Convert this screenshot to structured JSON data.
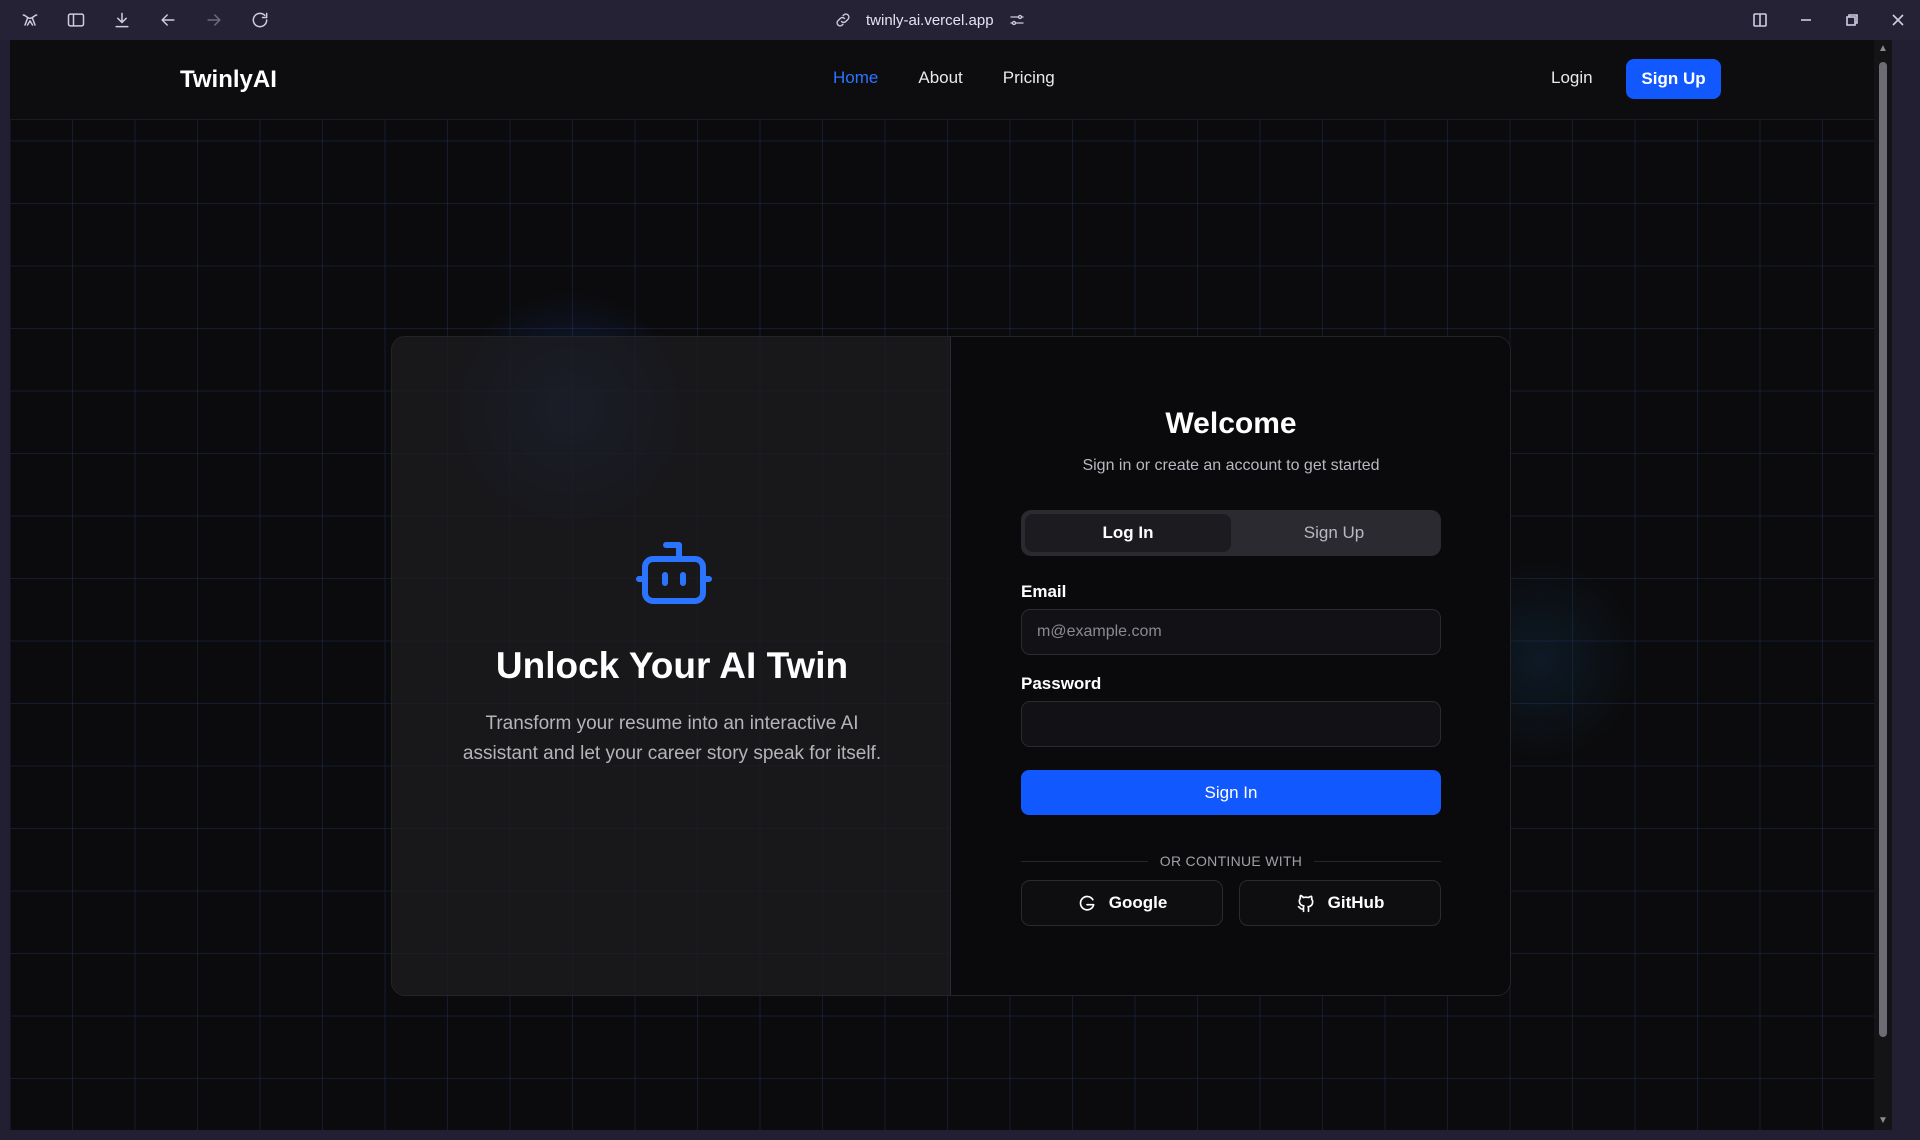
{
  "browser": {
    "url": "twinly-ai.vercel.app"
  },
  "nav": {
    "logo": "TwinlyAI",
    "links": [
      {
        "label": "Home",
        "active": true
      },
      {
        "label": "About",
        "active": false
      },
      {
        "label": "Pricing",
        "active": false
      }
    ],
    "login": "Login",
    "signup": "Sign Up"
  },
  "hero": {
    "icon": "bot-icon",
    "title": "Unlock Your AI Twin",
    "text": "Transform your resume into an interactive AI assistant and let your career story speak for itself."
  },
  "auth": {
    "title": "Welcome",
    "subtitle": "Sign in or create an account to get started",
    "tabs": [
      {
        "label": "Log In",
        "active": true
      },
      {
        "label": "Sign Up",
        "active": false
      }
    ],
    "email_label": "Email",
    "email_placeholder": "m@example.com",
    "email_value": "",
    "password_label": "Password",
    "password_value": "",
    "submit": "Sign In",
    "divider": "OR CONTINUE WITH",
    "google": "Google",
    "github": "GitHub"
  },
  "colors": {
    "accent": "#1158ff",
    "active_link": "#2b74ff",
    "background": "#0b0b0d"
  }
}
